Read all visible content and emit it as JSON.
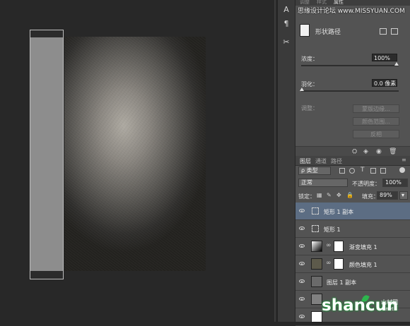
{
  "watermark_top": "思缘设计论坛 www.MISSYUAN.COM",
  "top_tabs": [
    "调整",
    "样式",
    "属性"
  ],
  "properties": {
    "title": "形状路径",
    "density_label": "浓度：",
    "density_value": "100%",
    "feather_label": "羽化：",
    "feather_value": "0.0 像素",
    "adjust_label": "调整：",
    "buttons": [
      "蒙版边缘...",
      "颜色范围...",
      "反相"
    ]
  },
  "layers_panel": {
    "tabs": [
      "图层",
      "通道",
      "路径"
    ],
    "filter_kind": "ρ 类型",
    "blend_mode": "正常",
    "opacity_label": "不透明度：",
    "opacity_value": "100%",
    "lock_label": "锁定：",
    "fill_label": "填充：",
    "fill_value": "89%",
    "layers": [
      {
        "name": "矩形 1 副本",
        "kind": "shape",
        "selected": true
      },
      {
        "name": "矩形 1",
        "kind": "shape",
        "selected": false
      },
      {
        "name": "渐变填充 1",
        "kind": "gradient",
        "selected": false
      },
      {
        "name": "颜色填充 1",
        "kind": "color",
        "selected": false
      },
      {
        "name": "图层 1 副本",
        "kind": "pixel",
        "selected": false
      }
    ]
  },
  "watermark_bottom": {
    "brand": "shancun",
    "cn": "山村网",
    "sub": ".net"
  },
  "colors": {
    "selected_layer": "#5c6d83",
    "panel_bg": "#535353",
    "canvas_bg": "#282828",
    "watermark_green": "#2db54d"
  }
}
